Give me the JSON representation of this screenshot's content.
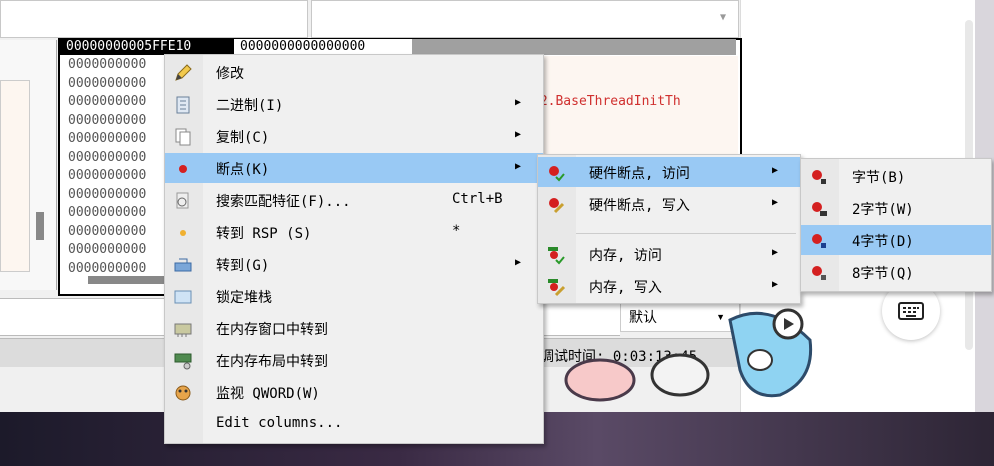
{
  "stack": {
    "selected_address": "00000000005FFE10",
    "second_column": "0000000000000000",
    "address_prefix": "0000000000",
    "comment": "32.BaseThreadInitTh"
  },
  "status": {
    "default_label": "默认",
    "debug_time": "调试时间:  0:03:13:45"
  },
  "context_menu": {
    "items": [
      {
        "label": "修改",
        "icon": "pencil-icon"
      },
      {
        "label": "二进制(I)",
        "icon": "binary-icon",
        "submenu": true
      },
      {
        "label": "复制(C)",
        "icon": "copy-icon",
        "submenu": true
      },
      {
        "label": "断点(K)",
        "icon": "breakpoint-icon",
        "submenu": true,
        "highlighted": true
      },
      {
        "label": "搜索匹配特征(F)...",
        "icon": "search-pattern-icon",
        "shortcut": "Ctrl+B"
      },
      {
        "label": "转到 RSP (S)",
        "icon": "star-icon",
        "shortcut": "*"
      },
      {
        "label": "转到(G)",
        "icon": "goto-icon",
        "submenu": true
      },
      {
        "label": "锁定堆栈",
        "icon": "lock-stack-icon"
      },
      {
        "label": "在内存窗口中转到",
        "icon": "memory-window-icon"
      },
      {
        "label": "在内存布局中转到",
        "icon": "memory-layout-icon"
      },
      {
        "label": "监视 QWORD(W)",
        "icon": "watch-icon"
      },
      {
        "label": "Edit columns...",
        "icon": ""
      }
    ]
  },
  "breakpoint_menu": {
    "items": [
      {
        "label": "硬件断点, 访问",
        "icon": "hw-access-icon",
        "submenu": true,
        "highlighted": true
      },
      {
        "label": "硬件断点, 写入",
        "icon": "hw-write-icon",
        "submenu": true
      },
      {
        "label": "内存, 访问",
        "icon": "mem-access-icon",
        "submenu": true
      },
      {
        "label": "内存, 写入",
        "icon": "mem-write-icon",
        "submenu": true
      }
    ]
  },
  "size_menu": {
    "items": [
      {
        "label": "字节(B)",
        "icon": "byte-icon"
      },
      {
        "label": "2字节(W)",
        "icon": "word-icon"
      },
      {
        "label": "4字节(D)",
        "icon": "dword-icon",
        "highlighted": true
      },
      {
        "label": "8字节(Q)",
        "icon": "qword-icon"
      }
    ]
  },
  "colors": {
    "highlight": "#99c9f4",
    "menu_bg": "#f0f0f0",
    "comment_red": "#d0302f"
  }
}
